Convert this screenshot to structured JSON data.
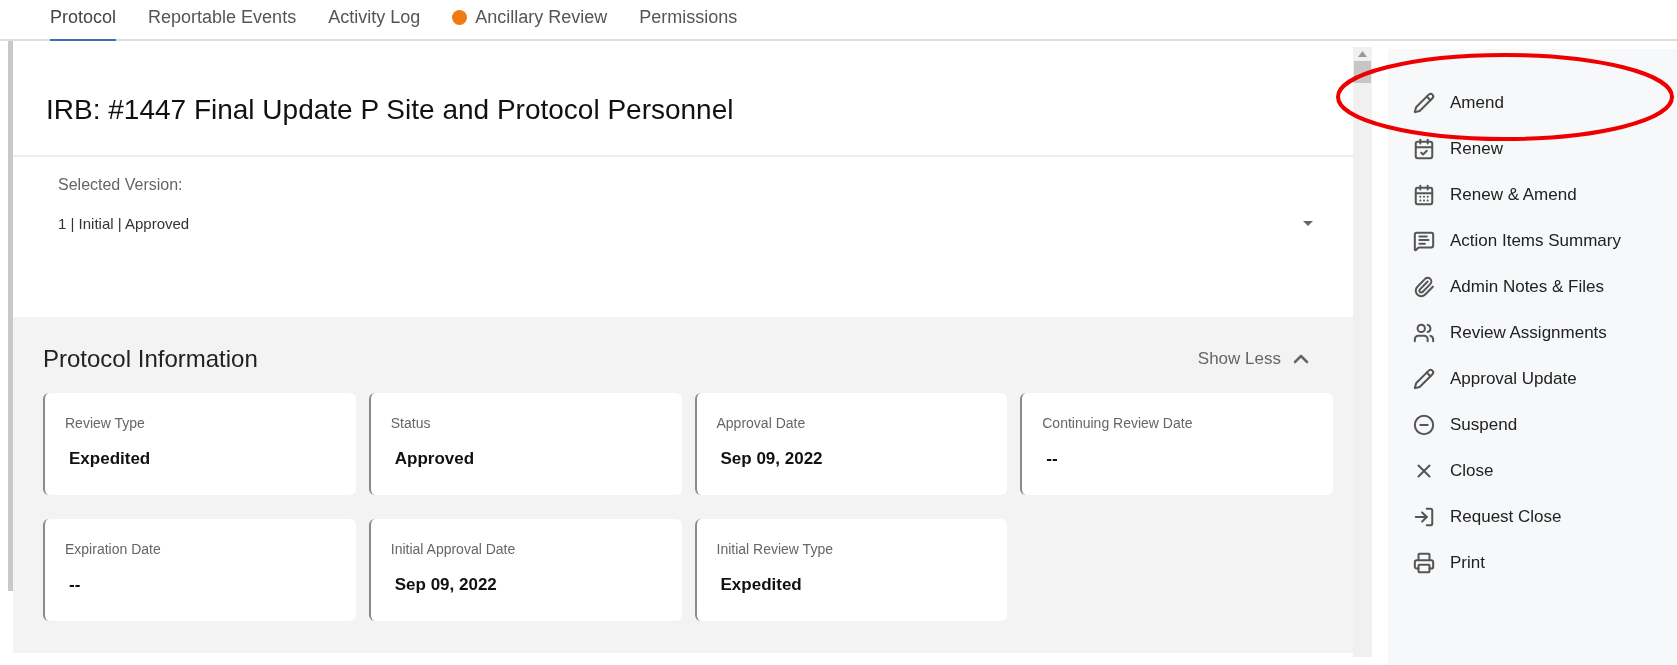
{
  "tabs": [
    {
      "label": "Protocol",
      "selected": true,
      "dot": false
    },
    {
      "label": "Reportable Events",
      "selected": false,
      "dot": false
    },
    {
      "label": "Activity Log",
      "selected": false,
      "dot": false
    },
    {
      "label": "Ancillary Review",
      "selected": false,
      "dot": true
    },
    {
      "label": "Permissions",
      "selected": false,
      "dot": false
    }
  ],
  "title": "IRB: #1447 Final Update P Site and Protocol Personnel",
  "version": {
    "label": "Selected Version:",
    "value": "1 | Initial | Approved"
  },
  "section": {
    "title": "Protocol Information",
    "toggle": "Show Less",
    "expanded": true,
    "cards": [
      {
        "label": "Review Type",
        "value": "Expedited"
      },
      {
        "label": "Status",
        "value": "Approved"
      },
      {
        "label": "Approval Date",
        "value": "Sep 09, 2022"
      },
      {
        "label": "Continuing Review Date",
        "value": "--"
      },
      {
        "label": "Expiration Date",
        "value": "--"
      },
      {
        "label": "Initial Approval Date",
        "value": "Sep 09, 2022"
      },
      {
        "label": "Initial Review Type",
        "value": "Expedited"
      }
    ]
  },
  "actions": [
    {
      "label": "Amend",
      "highlighted": true
    },
    {
      "label": "Renew",
      "highlighted": false
    },
    {
      "label": "Renew & Amend",
      "highlighted": false
    },
    {
      "label": "Action Items Summary",
      "highlighted": false
    },
    {
      "label": "Admin Notes & Files",
      "highlighted": false
    },
    {
      "label": "Review Assignments",
      "highlighted": false
    },
    {
      "label": "Approval Update",
      "highlighted": false
    },
    {
      "label": "Suspend",
      "highlighted": false
    },
    {
      "label": "Close",
      "highlighted": false
    },
    {
      "label": "Request Close",
      "highlighted": false
    },
    {
      "label": "Print",
      "highlighted": false
    }
  ]
}
